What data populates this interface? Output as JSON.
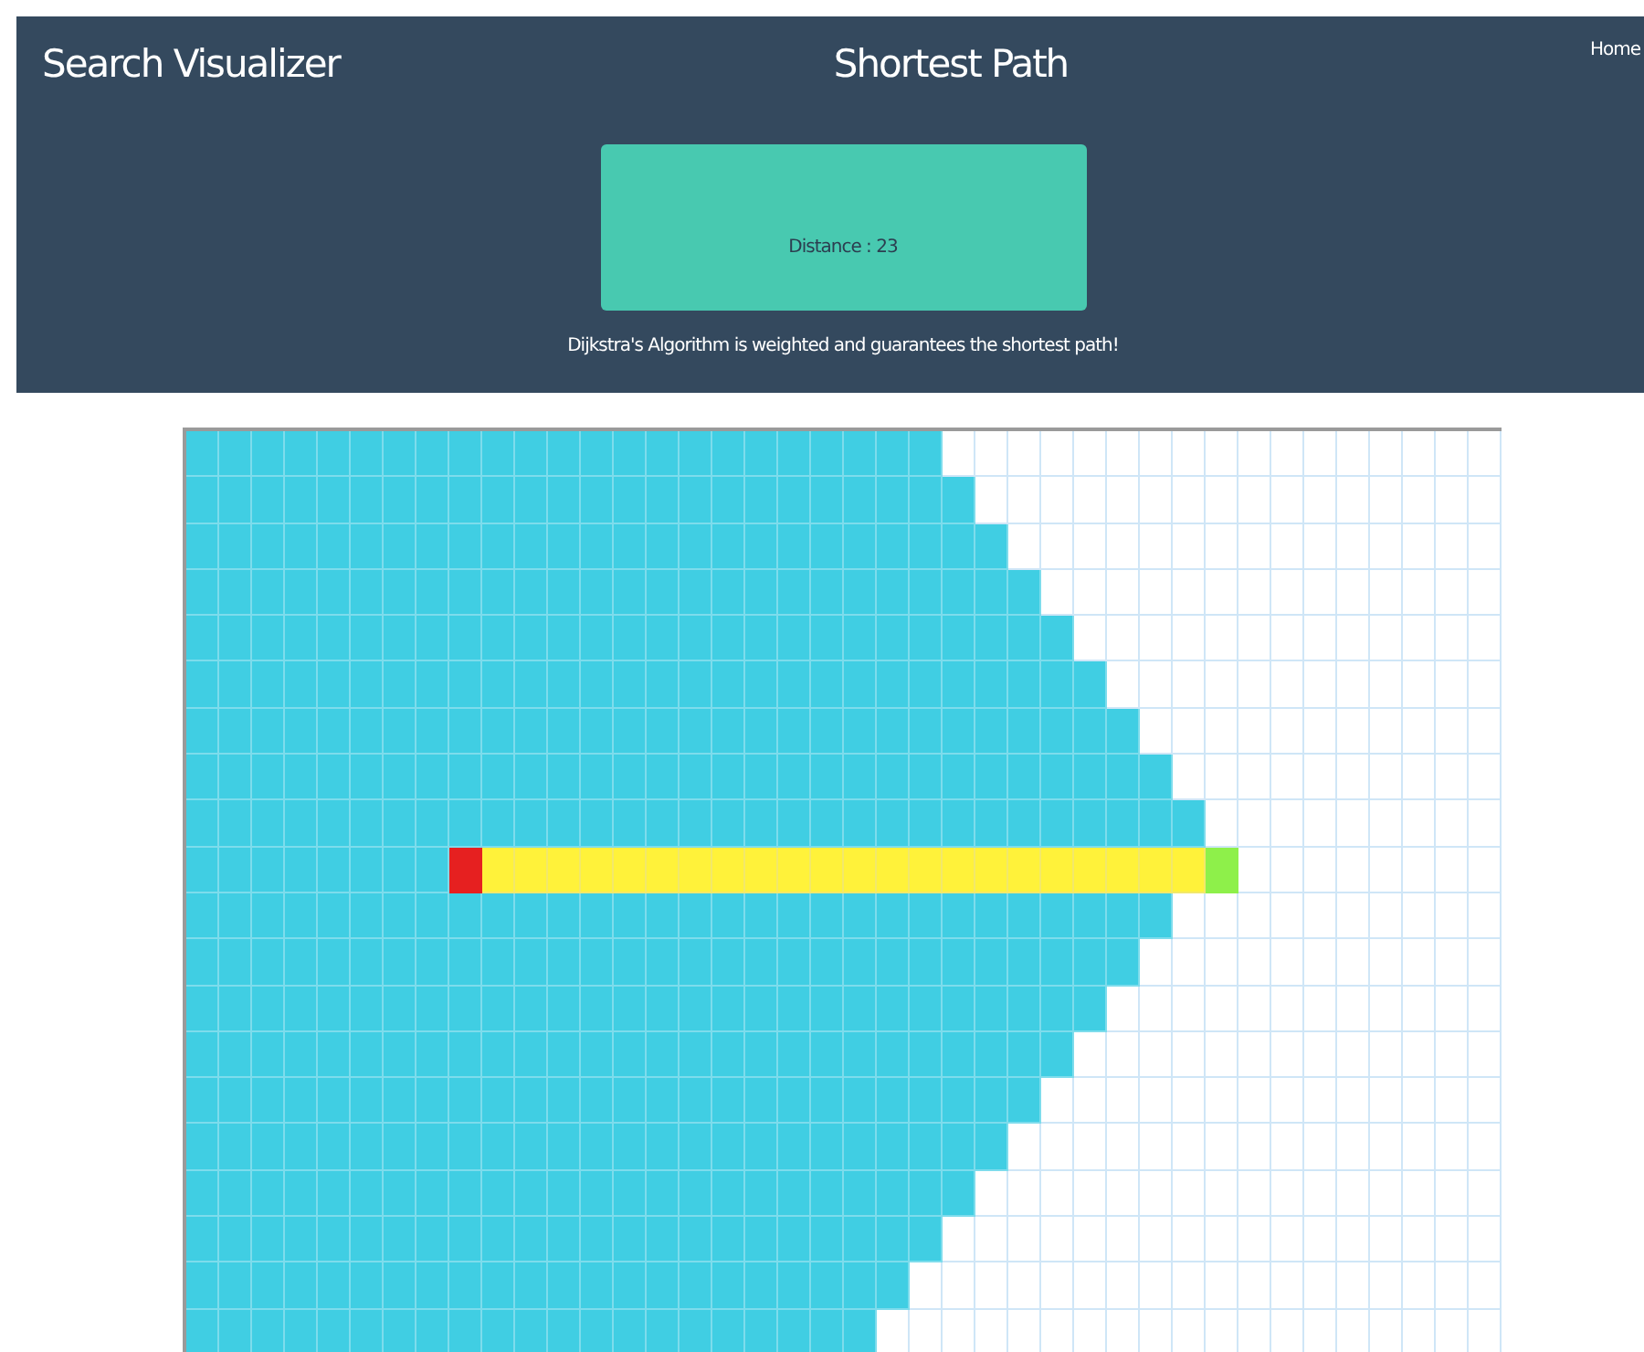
{
  "header": {
    "app_title": "Search Visualizer",
    "page_title": "Shortest Path",
    "nav_link": "Home",
    "result": "Distance : 23",
    "description": "Dijkstra's Algorithm is weighted and guarantees the shortest path!"
  },
  "grid": {
    "rows": [
      [
        {
          "kind": "visited"
        },
        {
          "kind": "visited"
        },
        {
          "kind": "visited"
        },
        {
          "kind": "visited"
        },
        {
          "kind": "visited"
        },
        {
          "kind": "visited"
        },
        {
          "kind": "visited"
        },
        {
          "kind": "visited"
        },
        {
          "kind": "visited"
        },
        {
          "kind": "visited"
        },
        {
          "kind": "visited"
        },
        {
          "kind": "visited"
        },
        {
          "kind": "visited"
        },
        {
          "kind": "visited"
        },
        {
          "kind": "visited"
        },
        {
          "kind": "visited"
        },
        {
          "kind": "visited"
        },
        {
          "kind": "visited"
        },
        {
          "kind": "visited"
        },
        {
          "kind": "visited"
        },
        {
          "kind": "visited"
        },
        {
          "kind": "visited"
        },
        {
          "kind": "visited"
        },
        {
          "kind": "open"
        },
        {
          "kind": "open"
        },
        {
          "kind": "open"
        },
        {
          "kind": "open"
        },
        {
          "kind": "open"
        },
        {
          "kind": "open"
        },
        {
          "kind": "open"
        },
        {
          "kind": "open"
        },
        {
          "kind": "open"
        },
        {
          "kind": "open"
        },
        {
          "kind": "open"
        },
        {
          "kind": "open"
        },
        {
          "kind": "open"
        },
        {
          "kind": "open"
        },
        {
          "kind": "open"
        },
        {
          "kind": "open"
        },
        {
          "kind": "open"
        }
      ],
      [
        {
          "kind": "visited"
        },
        {
          "kind": "visited"
        },
        {
          "kind": "visited"
        },
        {
          "kind": "visited"
        },
        {
          "kind": "visited"
        },
        {
          "kind": "visited"
        },
        {
          "kind": "visited"
        },
        {
          "kind": "visited"
        },
        {
          "kind": "visited"
        },
        {
          "kind": "visited"
        },
        {
          "kind": "visited"
        },
        {
          "kind": "visited"
        },
        {
          "kind": "visited"
        },
        {
          "kind": "visited"
        },
        {
          "kind": "visited"
        },
        {
          "kind": "visited"
        },
        {
          "kind": "visited"
        },
        {
          "kind": "visited"
        },
        {
          "kind": "visited"
        },
        {
          "kind": "visited"
        },
        {
          "kind": "visited"
        },
        {
          "kind": "visited"
        },
        {
          "kind": "visited"
        },
        {
          "kind": "visited"
        },
        {
          "kind": "open"
        },
        {
          "kind": "open"
        },
        {
          "kind": "open"
        },
        {
          "kind": "open"
        },
        {
          "kind": "open"
        },
        {
          "kind": "open"
        },
        {
          "kind": "open"
        },
        {
          "kind": "open"
        },
        {
          "kind": "open"
        },
        {
          "kind": "open"
        },
        {
          "kind": "open"
        },
        {
          "kind": "open"
        },
        {
          "kind": "open"
        },
        {
          "kind": "open"
        },
        {
          "kind": "open"
        },
        {
          "kind": "open"
        }
      ],
      [
        {
          "kind": "visited"
        },
        {
          "kind": "visited"
        },
        {
          "kind": "visited"
        },
        {
          "kind": "visited"
        },
        {
          "kind": "visited"
        },
        {
          "kind": "visited"
        },
        {
          "kind": "visited"
        },
        {
          "kind": "visited"
        },
        {
          "kind": "visited"
        },
        {
          "kind": "visited"
        },
        {
          "kind": "visited"
        },
        {
          "kind": "visited"
        },
        {
          "kind": "visited"
        },
        {
          "kind": "visited"
        },
        {
          "kind": "visited"
        },
        {
          "kind": "visited"
        },
        {
          "kind": "visited"
        },
        {
          "kind": "visited"
        },
        {
          "kind": "visited"
        },
        {
          "kind": "visited"
        },
        {
          "kind": "visited"
        },
        {
          "kind": "visited"
        },
        {
          "kind": "visited"
        },
        {
          "kind": "visited"
        },
        {
          "kind": "visited"
        },
        {
          "kind": "open"
        },
        {
          "kind": "open"
        },
        {
          "kind": "open"
        },
        {
          "kind": "open"
        },
        {
          "kind": "open"
        },
        {
          "kind": "open"
        },
        {
          "kind": "open"
        },
        {
          "kind": "open"
        },
        {
          "kind": "open"
        },
        {
          "kind": "open"
        },
        {
          "kind": "open"
        },
        {
          "kind": "open"
        },
        {
          "kind": "open"
        },
        {
          "kind": "open"
        },
        {
          "kind": "open"
        }
      ],
      [
        {
          "kind": "visited"
        },
        {
          "kind": "visited"
        },
        {
          "kind": "visited"
        },
        {
          "kind": "visited"
        },
        {
          "kind": "visited"
        },
        {
          "kind": "visited"
        },
        {
          "kind": "visited"
        },
        {
          "kind": "visited"
        },
        {
          "kind": "visited"
        },
        {
          "kind": "visited"
        },
        {
          "kind": "visited"
        },
        {
          "kind": "visited"
        },
        {
          "kind": "visited"
        },
        {
          "kind": "visited"
        },
        {
          "kind": "visited"
        },
        {
          "kind": "visited"
        },
        {
          "kind": "visited"
        },
        {
          "kind": "visited"
        },
        {
          "kind": "visited"
        },
        {
          "kind": "visited"
        },
        {
          "kind": "visited"
        },
        {
          "kind": "visited"
        },
        {
          "kind": "visited"
        },
        {
          "kind": "visited"
        },
        {
          "kind": "visited"
        },
        {
          "kind": "visited"
        },
        {
          "kind": "open"
        },
        {
          "kind": "open"
        },
        {
          "kind": "open"
        },
        {
          "kind": "open"
        },
        {
          "kind": "open"
        },
        {
          "kind": "open"
        },
        {
          "kind": "open"
        },
        {
          "kind": "open"
        },
        {
          "kind": "open"
        },
        {
          "kind": "open"
        },
        {
          "kind": "open"
        },
        {
          "kind": "open"
        },
        {
          "kind": "open"
        },
        {
          "kind": "open"
        }
      ],
      [
        {
          "kind": "visited"
        },
        {
          "kind": "visited"
        },
        {
          "kind": "visited"
        },
        {
          "kind": "visited"
        },
        {
          "kind": "visited"
        },
        {
          "kind": "visited"
        },
        {
          "kind": "visited"
        },
        {
          "kind": "visited"
        },
        {
          "kind": "visited"
        },
        {
          "kind": "visited"
        },
        {
          "kind": "visited"
        },
        {
          "kind": "visited"
        },
        {
          "kind": "visited"
        },
        {
          "kind": "visited"
        },
        {
          "kind": "visited"
        },
        {
          "kind": "visited"
        },
        {
          "kind": "visited"
        },
        {
          "kind": "visited"
        },
        {
          "kind": "visited"
        },
        {
          "kind": "visited"
        },
        {
          "kind": "visited"
        },
        {
          "kind": "visited"
        },
        {
          "kind": "visited"
        },
        {
          "kind": "visited"
        },
        {
          "kind": "visited"
        },
        {
          "kind": "visited"
        },
        {
          "kind": "visited"
        },
        {
          "kind": "open"
        },
        {
          "kind": "open"
        },
        {
          "kind": "open"
        },
        {
          "kind": "open"
        },
        {
          "kind": "open"
        },
        {
          "kind": "open"
        },
        {
          "kind": "open"
        },
        {
          "kind": "open"
        },
        {
          "kind": "open"
        },
        {
          "kind": "open"
        },
        {
          "kind": "open"
        },
        {
          "kind": "open"
        },
        {
          "kind": "open"
        }
      ],
      [
        {
          "kind": "visited"
        },
        {
          "kind": "visited"
        },
        {
          "kind": "visited"
        },
        {
          "kind": "visited"
        },
        {
          "kind": "visited"
        },
        {
          "kind": "visited"
        },
        {
          "kind": "visited"
        },
        {
          "kind": "visited"
        },
        {
          "kind": "visited"
        },
        {
          "kind": "visited"
        },
        {
          "kind": "visited"
        },
        {
          "kind": "visited"
        },
        {
          "kind": "visited"
        },
        {
          "kind": "visited"
        },
        {
          "kind": "visited"
        },
        {
          "kind": "visited"
        },
        {
          "kind": "visited"
        },
        {
          "kind": "visited"
        },
        {
          "kind": "visited"
        },
        {
          "kind": "visited"
        },
        {
          "kind": "visited"
        },
        {
          "kind": "visited"
        },
        {
          "kind": "visited"
        },
        {
          "kind": "visited"
        },
        {
          "kind": "visited"
        },
        {
          "kind": "visited"
        },
        {
          "kind": "visited"
        },
        {
          "kind": "visited"
        },
        {
          "kind": "open"
        },
        {
          "kind": "open"
        },
        {
          "kind": "open"
        },
        {
          "kind": "open"
        },
        {
          "kind": "open"
        },
        {
          "kind": "open"
        },
        {
          "kind": "open"
        },
        {
          "kind": "open"
        },
        {
          "kind": "open"
        },
        {
          "kind": "open"
        },
        {
          "kind": "open"
        },
        {
          "kind": "open"
        }
      ],
      [
        {
          "kind": "visited"
        },
        {
          "kind": "visited"
        },
        {
          "kind": "visited"
        },
        {
          "kind": "visited"
        },
        {
          "kind": "visited"
        },
        {
          "kind": "visited"
        },
        {
          "kind": "visited"
        },
        {
          "kind": "visited"
        },
        {
          "kind": "visited"
        },
        {
          "kind": "visited"
        },
        {
          "kind": "visited"
        },
        {
          "kind": "visited"
        },
        {
          "kind": "visited"
        },
        {
          "kind": "visited"
        },
        {
          "kind": "visited"
        },
        {
          "kind": "visited"
        },
        {
          "kind": "visited"
        },
        {
          "kind": "visited"
        },
        {
          "kind": "visited"
        },
        {
          "kind": "visited"
        },
        {
          "kind": "visited"
        },
        {
          "kind": "visited"
        },
        {
          "kind": "visited"
        },
        {
          "kind": "visited"
        },
        {
          "kind": "visited"
        },
        {
          "kind": "visited"
        },
        {
          "kind": "visited"
        },
        {
          "kind": "visited"
        },
        {
          "kind": "visited"
        },
        {
          "kind": "open"
        },
        {
          "kind": "open"
        },
        {
          "kind": "open"
        },
        {
          "kind": "open"
        },
        {
          "kind": "open"
        },
        {
          "kind": "open"
        },
        {
          "kind": "open"
        },
        {
          "kind": "open"
        },
        {
          "kind": "open"
        },
        {
          "kind": "open"
        },
        {
          "kind": "open"
        }
      ],
      [
        {
          "kind": "visited"
        },
        {
          "kind": "visited"
        },
        {
          "kind": "visited"
        },
        {
          "kind": "visited"
        },
        {
          "kind": "visited"
        },
        {
          "kind": "visited"
        },
        {
          "kind": "visited"
        },
        {
          "kind": "visited"
        },
        {
          "kind": "visited"
        },
        {
          "kind": "visited"
        },
        {
          "kind": "visited"
        },
        {
          "kind": "visited"
        },
        {
          "kind": "visited"
        },
        {
          "kind": "visited"
        },
        {
          "kind": "visited"
        },
        {
          "kind": "visited"
        },
        {
          "kind": "visited"
        },
        {
          "kind": "visited"
        },
        {
          "kind": "visited"
        },
        {
          "kind": "visited"
        },
        {
          "kind": "visited"
        },
        {
          "kind": "visited"
        },
        {
          "kind": "visited"
        },
        {
          "kind": "visited"
        },
        {
          "kind": "visited"
        },
        {
          "kind": "visited"
        },
        {
          "kind": "visited"
        },
        {
          "kind": "visited"
        },
        {
          "kind": "visited"
        },
        {
          "kind": "visited"
        },
        {
          "kind": "open"
        },
        {
          "kind": "open"
        },
        {
          "kind": "open"
        },
        {
          "kind": "open"
        },
        {
          "kind": "open"
        },
        {
          "kind": "open"
        },
        {
          "kind": "open"
        },
        {
          "kind": "open"
        },
        {
          "kind": "open"
        },
        {
          "kind": "open"
        }
      ],
      [
        {
          "kind": "visited"
        },
        {
          "kind": "visited"
        },
        {
          "kind": "visited"
        },
        {
          "kind": "visited"
        },
        {
          "kind": "visited"
        },
        {
          "kind": "visited"
        },
        {
          "kind": "visited"
        },
        {
          "kind": "visited"
        },
        {
          "kind": "visited"
        },
        {
          "kind": "visited"
        },
        {
          "kind": "visited"
        },
        {
          "kind": "visited"
        },
        {
          "kind": "visited"
        },
        {
          "kind": "visited"
        },
        {
          "kind": "visited"
        },
        {
          "kind": "visited"
        },
        {
          "kind": "visited"
        },
        {
          "kind": "visited"
        },
        {
          "kind": "visited"
        },
        {
          "kind": "visited"
        },
        {
          "kind": "visited"
        },
        {
          "kind": "visited"
        },
        {
          "kind": "visited"
        },
        {
          "kind": "visited"
        },
        {
          "kind": "visited"
        },
        {
          "kind": "visited"
        },
        {
          "kind": "visited"
        },
        {
          "kind": "visited"
        },
        {
          "kind": "visited"
        },
        {
          "kind": "visited"
        },
        {
          "kind": "visited"
        },
        {
          "kind": "open"
        },
        {
          "kind": "open"
        },
        {
          "kind": "open"
        },
        {
          "kind": "open"
        },
        {
          "kind": "open"
        },
        {
          "kind": "open"
        },
        {
          "kind": "open"
        },
        {
          "kind": "open"
        },
        {
          "kind": "open"
        }
      ],
      [
        {
          "kind": "visited"
        },
        {
          "kind": "visited"
        },
        {
          "kind": "visited"
        },
        {
          "kind": "visited"
        },
        {
          "kind": "visited"
        },
        {
          "kind": "visited"
        },
        {
          "kind": "visited"
        },
        {
          "kind": "visited"
        },
        {
          "kind": "start"
        },
        {
          "kind": "path"
        },
        {
          "kind": "path"
        },
        {
          "kind": "path"
        },
        {
          "kind": "path"
        },
        {
          "kind": "path"
        },
        {
          "kind": "path"
        },
        {
          "kind": "path"
        },
        {
          "kind": "path"
        },
        {
          "kind": "path"
        },
        {
          "kind": "path"
        },
        {
          "kind": "path"
        },
        {
          "kind": "path"
        },
        {
          "kind": "path"
        },
        {
          "kind": "path"
        },
        {
          "kind": "path"
        },
        {
          "kind": "path"
        },
        {
          "kind": "path"
        },
        {
          "kind": "path"
        },
        {
          "kind": "path"
        },
        {
          "kind": "path"
        },
        {
          "kind": "path"
        },
        {
          "kind": "path"
        },
        {
          "kind": "end"
        },
        {
          "kind": "open"
        },
        {
          "kind": "open"
        },
        {
          "kind": "open"
        },
        {
          "kind": "open"
        },
        {
          "kind": "open"
        },
        {
          "kind": "open"
        },
        {
          "kind": "open"
        },
        {
          "kind": "open"
        }
      ],
      [
        {
          "kind": "visited"
        },
        {
          "kind": "visited"
        },
        {
          "kind": "visited"
        },
        {
          "kind": "visited"
        },
        {
          "kind": "visited"
        },
        {
          "kind": "visited"
        },
        {
          "kind": "visited"
        },
        {
          "kind": "visited"
        },
        {
          "kind": "visited"
        },
        {
          "kind": "visited"
        },
        {
          "kind": "visited"
        },
        {
          "kind": "visited"
        },
        {
          "kind": "visited"
        },
        {
          "kind": "visited"
        },
        {
          "kind": "visited"
        },
        {
          "kind": "visited"
        },
        {
          "kind": "visited"
        },
        {
          "kind": "visited"
        },
        {
          "kind": "visited"
        },
        {
          "kind": "visited"
        },
        {
          "kind": "visited"
        },
        {
          "kind": "visited"
        },
        {
          "kind": "visited"
        },
        {
          "kind": "visited"
        },
        {
          "kind": "visited"
        },
        {
          "kind": "visited"
        },
        {
          "kind": "visited"
        },
        {
          "kind": "visited"
        },
        {
          "kind": "visited"
        },
        {
          "kind": "visited"
        },
        {
          "kind": "open"
        },
        {
          "kind": "open"
        },
        {
          "kind": "open"
        },
        {
          "kind": "open"
        },
        {
          "kind": "open"
        },
        {
          "kind": "open"
        },
        {
          "kind": "open"
        },
        {
          "kind": "open"
        },
        {
          "kind": "open"
        },
        {
          "kind": "open"
        }
      ],
      [
        {
          "kind": "visited"
        },
        {
          "kind": "visited"
        },
        {
          "kind": "visited"
        },
        {
          "kind": "visited"
        },
        {
          "kind": "visited"
        },
        {
          "kind": "visited"
        },
        {
          "kind": "visited"
        },
        {
          "kind": "visited"
        },
        {
          "kind": "visited"
        },
        {
          "kind": "visited"
        },
        {
          "kind": "visited"
        },
        {
          "kind": "visited"
        },
        {
          "kind": "visited"
        },
        {
          "kind": "visited"
        },
        {
          "kind": "visited"
        },
        {
          "kind": "visited"
        },
        {
          "kind": "visited"
        },
        {
          "kind": "visited"
        },
        {
          "kind": "visited"
        },
        {
          "kind": "visited"
        },
        {
          "kind": "visited"
        },
        {
          "kind": "visited"
        },
        {
          "kind": "visited"
        },
        {
          "kind": "visited"
        },
        {
          "kind": "visited"
        },
        {
          "kind": "visited"
        },
        {
          "kind": "visited"
        },
        {
          "kind": "visited"
        },
        {
          "kind": "visited"
        },
        {
          "kind": "open"
        },
        {
          "kind": "open"
        },
        {
          "kind": "open"
        },
        {
          "kind": "open"
        },
        {
          "kind": "open"
        },
        {
          "kind": "open"
        },
        {
          "kind": "open"
        },
        {
          "kind": "open"
        },
        {
          "kind": "open"
        },
        {
          "kind": "open"
        },
        {
          "kind": "open"
        }
      ],
      [
        {
          "kind": "visited"
        },
        {
          "kind": "visited"
        },
        {
          "kind": "visited"
        },
        {
          "kind": "visited"
        },
        {
          "kind": "visited"
        },
        {
          "kind": "visited"
        },
        {
          "kind": "visited"
        },
        {
          "kind": "visited"
        },
        {
          "kind": "visited"
        },
        {
          "kind": "visited"
        },
        {
          "kind": "visited"
        },
        {
          "kind": "visited"
        },
        {
          "kind": "visited"
        },
        {
          "kind": "visited"
        },
        {
          "kind": "visited"
        },
        {
          "kind": "visited"
        },
        {
          "kind": "visited"
        },
        {
          "kind": "visited"
        },
        {
          "kind": "visited"
        },
        {
          "kind": "visited"
        },
        {
          "kind": "visited"
        },
        {
          "kind": "visited"
        },
        {
          "kind": "visited"
        },
        {
          "kind": "visited"
        },
        {
          "kind": "visited"
        },
        {
          "kind": "visited"
        },
        {
          "kind": "visited"
        },
        {
          "kind": "visited"
        },
        {
          "kind": "open"
        },
        {
          "kind": "open"
        },
        {
          "kind": "open"
        },
        {
          "kind": "open"
        },
        {
          "kind": "open"
        },
        {
          "kind": "open"
        },
        {
          "kind": "open"
        },
        {
          "kind": "open"
        },
        {
          "kind": "open"
        },
        {
          "kind": "open"
        },
        {
          "kind": "open"
        },
        {
          "kind": "open"
        }
      ],
      [
        {
          "kind": "visited"
        },
        {
          "kind": "visited"
        },
        {
          "kind": "visited"
        },
        {
          "kind": "visited"
        },
        {
          "kind": "visited"
        },
        {
          "kind": "visited"
        },
        {
          "kind": "visited"
        },
        {
          "kind": "visited"
        },
        {
          "kind": "visited"
        },
        {
          "kind": "visited"
        },
        {
          "kind": "visited"
        },
        {
          "kind": "visited"
        },
        {
          "kind": "visited"
        },
        {
          "kind": "visited"
        },
        {
          "kind": "visited"
        },
        {
          "kind": "visited"
        },
        {
          "kind": "visited"
        },
        {
          "kind": "visited"
        },
        {
          "kind": "visited"
        },
        {
          "kind": "visited"
        },
        {
          "kind": "visited"
        },
        {
          "kind": "visited"
        },
        {
          "kind": "visited"
        },
        {
          "kind": "visited"
        },
        {
          "kind": "visited"
        },
        {
          "kind": "visited"
        },
        {
          "kind": "visited"
        },
        {
          "kind": "open"
        },
        {
          "kind": "open"
        },
        {
          "kind": "open"
        },
        {
          "kind": "open"
        },
        {
          "kind": "open"
        },
        {
          "kind": "open"
        },
        {
          "kind": "open"
        },
        {
          "kind": "open"
        },
        {
          "kind": "open"
        },
        {
          "kind": "open"
        },
        {
          "kind": "open"
        },
        {
          "kind": "open"
        },
        {
          "kind": "open"
        }
      ],
      [
        {
          "kind": "visited"
        },
        {
          "kind": "visited"
        },
        {
          "kind": "visited"
        },
        {
          "kind": "visited"
        },
        {
          "kind": "visited"
        },
        {
          "kind": "visited"
        },
        {
          "kind": "visited"
        },
        {
          "kind": "visited"
        },
        {
          "kind": "visited"
        },
        {
          "kind": "visited"
        },
        {
          "kind": "visited"
        },
        {
          "kind": "visited"
        },
        {
          "kind": "visited"
        },
        {
          "kind": "visited"
        },
        {
          "kind": "visited"
        },
        {
          "kind": "visited"
        },
        {
          "kind": "visited"
        },
        {
          "kind": "visited"
        },
        {
          "kind": "visited"
        },
        {
          "kind": "visited"
        },
        {
          "kind": "visited"
        },
        {
          "kind": "visited"
        },
        {
          "kind": "visited"
        },
        {
          "kind": "visited"
        },
        {
          "kind": "visited"
        },
        {
          "kind": "visited"
        },
        {
          "kind": "open"
        },
        {
          "kind": "open"
        },
        {
          "kind": "open"
        },
        {
          "kind": "open"
        },
        {
          "kind": "open"
        },
        {
          "kind": "open"
        },
        {
          "kind": "open"
        },
        {
          "kind": "open"
        },
        {
          "kind": "open"
        },
        {
          "kind": "open"
        },
        {
          "kind": "open"
        },
        {
          "kind": "open"
        },
        {
          "kind": "open"
        },
        {
          "kind": "open"
        }
      ],
      [
        {
          "kind": "visited"
        },
        {
          "kind": "visited"
        },
        {
          "kind": "visited"
        },
        {
          "kind": "visited"
        },
        {
          "kind": "visited"
        },
        {
          "kind": "visited"
        },
        {
          "kind": "visited"
        },
        {
          "kind": "visited"
        },
        {
          "kind": "visited"
        },
        {
          "kind": "visited"
        },
        {
          "kind": "visited"
        },
        {
          "kind": "visited"
        },
        {
          "kind": "visited"
        },
        {
          "kind": "visited"
        },
        {
          "kind": "visited"
        },
        {
          "kind": "visited"
        },
        {
          "kind": "visited"
        },
        {
          "kind": "visited"
        },
        {
          "kind": "visited"
        },
        {
          "kind": "visited"
        },
        {
          "kind": "visited"
        },
        {
          "kind": "visited"
        },
        {
          "kind": "visited"
        },
        {
          "kind": "visited"
        },
        {
          "kind": "visited"
        },
        {
          "kind": "open"
        },
        {
          "kind": "open"
        },
        {
          "kind": "open"
        },
        {
          "kind": "open"
        },
        {
          "kind": "open"
        },
        {
          "kind": "open"
        },
        {
          "kind": "open"
        },
        {
          "kind": "open"
        },
        {
          "kind": "open"
        },
        {
          "kind": "open"
        },
        {
          "kind": "open"
        },
        {
          "kind": "open"
        },
        {
          "kind": "open"
        },
        {
          "kind": "open"
        },
        {
          "kind": "open"
        }
      ],
      [
        {
          "kind": "visited"
        },
        {
          "kind": "visited"
        },
        {
          "kind": "visited"
        },
        {
          "kind": "visited"
        },
        {
          "kind": "visited"
        },
        {
          "kind": "visited"
        },
        {
          "kind": "visited"
        },
        {
          "kind": "visited"
        },
        {
          "kind": "visited"
        },
        {
          "kind": "visited"
        },
        {
          "kind": "visited"
        },
        {
          "kind": "visited"
        },
        {
          "kind": "visited"
        },
        {
          "kind": "visited"
        },
        {
          "kind": "visited"
        },
        {
          "kind": "visited"
        },
        {
          "kind": "visited"
        },
        {
          "kind": "visited"
        },
        {
          "kind": "visited"
        },
        {
          "kind": "visited"
        },
        {
          "kind": "visited"
        },
        {
          "kind": "visited"
        },
        {
          "kind": "visited"
        },
        {
          "kind": "visited"
        },
        {
          "kind": "open"
        },
        {
          "kind": "open"
        },
        {
          "kind": "open"
        },
        {
          "kind": "open"
        },
        {
          "kind": "open"
        },
        {
          "kind": "open"
        },
        {
          "kind": "open"
        },
        {
          "kind": "open"
        },
        {
          "kind": "open"
        },
        {
          "kind": "open"
        },
        {
          "kind": "open"
        },
        {
          "kind": "open"
        },
        {
          "kind": "open"
        },
        {
          "kind": "open"
        },
        {
          "kind": "open"
        },
        {
          "kind": "open"
        }
      ],
      [
        {
          "kind": "visited"
        },
        {
          "kind": "visited"
        },
        {
          "kind": "visited"
        },
        {
          "kind": "visited"
        },
        {
          "kind": "visited"
        },
        {
          "kind": "visited"
        },
        {
          "kind": "visited"
        },
        {
          "kind": "visited"
        },
        {
          "kind": "visited"
        },
        {
          "kind": "visited"
        },
        {
          "kind": "visited"
        },
        {
          "kind": "visited"
        },
        {
          "kind": "visited"
        },
        {
          "kind": "visited"
        },
        {
          "kind": "visited"
        },
        {
          "kind": "visited"
        },
        {
          "kind": "visited"
        },
        {
          "kind": "visited"
        },
        {
          "kind": "visited"
        },
        {
          "kind": "visited"
        },
        {
          "kind": "visited"
        },
        {
          "kind": "visited"
        },
        {
          "kind": "visited"
        },
        {
          "kind": "open"
        },
        {
          "kind": "open"
        },
        {
          "kind": "open"
        },
        {
          "kind": "open"
        },
        {
          "kind": "open"
        },
        {
          "kind": "open"
        },
        {
          "kind": "open"
        },
        {
          "kind": "open"
        },
        {
          "kind": "open"
        },
        {
          "kind": "open"
        },
        {
          "kind": "open"
        },
        {
          "kind": "open"
        },
        {
          "kind": "open"
        },
        {
          "kind": "open"
        },
        {
          "kind": "open"
        },
        {
          "kind": "open"
        },
        {
          "kind": "open"
        }
      ],
      [
        {
          "kind": "visited"
        },
        {
          "kind": "visited"
        },
        {
          "kind": "visited"
        },
        {
          "kind": "visited"
        },
        {
          "kind": "visited"
        },
        {
          "kind": "visited"
        },
        {
          "kind": "visited"
        },
        {
          "kind": "visited"
        },
        {
          "kind": "visited"
        },
        {
          "kind": "visited"
        },
        {
          "kind": "visited"
        },
        {
          "kind": "visited"
        },
        {
          "kind": "visited"
        },
        {
          "kind": "visited"
        },
        {
          "kind": "visited"
        },
        {
          "kind": "visited"
        },
        {
          "kind": "visited"
        },
        {
          "kind": "visited"
        },
        {
          "kind": "visited"
        },
        {
          "kind": "visited"
        },
        {
          "kind": "visited"
        },
        {
          "kind": "visited"
        },
        {
          "kind": "open"
        },
        {
          "kind": "open"
        },
        {
          "kind": "open"
        },
        {
          "kind": "open"
        },
        {
          "kind": "open"
        },
        {
          "kind": "open"
        },
        {
          "kind": "open"
        },
        {
          "kind": "open"
        },
        {
          "kind": "open"
        },
        {
          "kind": "open"
        },
        {
          "kind": "open"
        },
        {
          "kind": "open"
        },
        {
          "kind": "open"
        },
        {
          "kind": "open"
        },
        {
          "kind": "open"
        },
        {
          "kind": "open"
        },
        {
          "kind": "open"
        },
        {
          "kind": "open"
        }
      ],
      [
        {
          "kind": "visited"
        },
        {
          "kind": "visited"
        },
        {
          "kind": "visited"
        },
        {
          "kind": "visited"
        },
        {
          "kind": "visited"
        },
        {
          "kind": "visited"
        },
        {
          "kind": "visited"
        },
        {
          "kind": "visited"
        },
        {
          "kind": "visited"
        },
        {
          "kind": "visited"
        },
        {
          "kind": "visited"
        },
        {
          "kind": "visited"
        },
        {
          "kind": "visited"
        },
        {
          "kind": "visited"
        },
        {
          "kind": "visited"
        },
        {
          "kind": "visited"
        },
        {
          "kind": "visited"
        },
        {
          "kind": "visited"
        },
        {
          "kind": "visited"
        },
        {
          "kind": "visited"
        },
        {
          "kind": "visited"
        },
        {
          "kind": "open"
        },
        {
          "kind": "open"
        },
        {
          "kind": "open"
        },
        {
          "kind": "open"
        },
        {
          "kind": "open"
        },
        {
          "kind": "open"
        },
        {
          "kind": "open"
        },
        {
          "kind": "open"
        },
        {
          "kind": "open"
        },
        {
          "kind": "open"
        },
        {
          "kind": "open"
        },
        {
          "kind": "open"
        },
        {
          "kind": "open"
        },
        {
          "kind": "open"
        },
        {
          "kind": "open"
        },
        {
          "kind": "open"
        },
        {
          "kind": "open"
        },
        {
          "kind": "open"
        },
        {
          "kind": "open"
        }
      ]
    ]
  }
}
